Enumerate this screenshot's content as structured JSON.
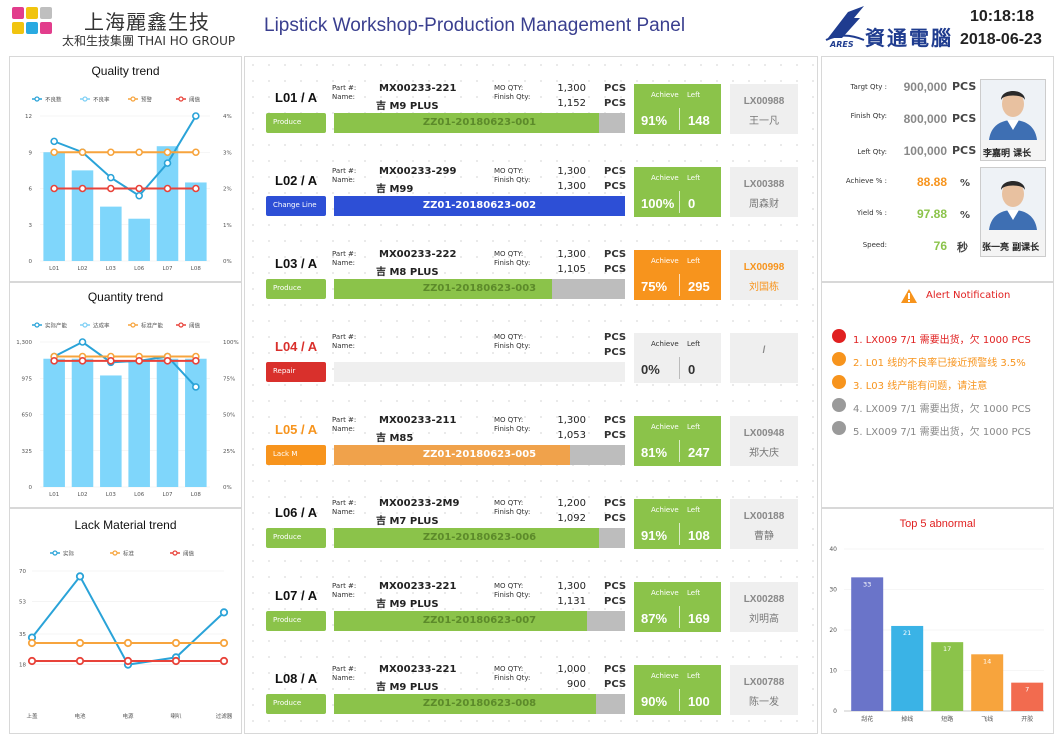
{
  "header": {
    "brand_cn": "上海麗鑫生技",
    "brand_en": "太和生技集團 THAI HO GROUP",
    "title": "Lipstick Workshop-Production Management Panel",
    "partner_logo_text": "ARES",
    "partner_name": "資通電腦",
    "time": "10:18:18",
    "date": "2018-06-23"
  },
  "quality_trend": {
    "title": "Quality trend",
    "legend": [
      "不良数",
      "不良率",
      "预警",
      "阈值"
    ],
    "chart_data": {
      "type": "bar",
      "categories": [
        "L01",
        "L02",
        "L03",
        "L06",
        "L07",
        "L08"
      ],
      "series": [
        {
          "name": "不良数",
          "values": [
            9,
            7.5,
            4.5,
            3.5,
            9.5,
            6.5
          ]
        },
        {
          "name": "不良率",
          "values": [
            3.3,
            3.0,
            2.3,
            1.8,
            2.7,
            4.0
          ]
        },
        {
          "name": "预警",
          "values": [
            3,
            3,
            3,
            3,
            3,
            3
          ]
        },
        {
          "name": "阈值",
          "values": [
            2,
            2,
            2,
            2,
            2,
            2
          ]
        }
      ],
      "ylim": [
        0,
        12
      ],
      "y2lim": [
        0,
        4
      ],
      "yticks": [
        "0",
        "3",
        "6",
        "9",
        "12"
      ],
      "y2ticks": [
        "0%",
        "1%",
        "2%",
        "3%",
        "4%"
      ]
    }
  },
  "quantity_trend": {
    "title": "Quantity trend",
    "legend": [
      "实际产能",
      "达成率",
      "标准产能",
      "阈值"
    ],
    "chart_data": {
      "type": "bar",
      "categories": [
        "L01",
        "L02",
        "L03",
        "L06",
        "L07",
        "L08"
      ],
      "series": [
        {
          "name": "实际产能",
          "values": [
            1150,
            1150,
            1000,
            1130,
            1150,
            1150
          ]
        },
        {
          "name": "达成率",
          "values": [
            90,
            100,
            86,
            87,
            90,
            69
          ]
        },
        {
          "name": "标准产能",
          "values": [
            90,
            90,
            90,
            90,
            90,
            90
          ]
        },
        {
          "name": "阈值",
          "values": [
            87,
            87,
            87,
            87,
            87,
            87
          ]
        }
      ],
      "ylim": [
        0,
        1300
      ],
      "y2lim": [
        0,
        100
      ],
      "yticks": [
        "0",
        "325",
        "650",
        "975",
        "1,300"
      ],
      "y2ticks": [
        "0%",
        "25%",
        "50%",
        "75%",
        "100%"
      ]
    }
  },
  "lack_trend": {
    "title": "Lack Material trend",
    "legend": [
      "实际",
      "标准",
      "阈值"
    ],
    "chart_data": {
      "type": "line",
      "categories": [
        "上盖",
        "电池",
        "电源",
        "喇叭",
        "过滤器"
      ],
      "series": [
        {
          "name": "实际",
          "values": [
            33,
            67,
            18,
            22,
            47
          ]
        },
        {
          "name": "标准",
          "values": [
            30,
            30,
            30,
            30,
            30
          ]
        },
        {
          "name": "阈值",
          "values": [
            20,
            20,
            20,
            20,
            20
          ]
        }
      ],
      "ylim": [
        0,
        70
      ],
      "yticks": [
        "18",
        "35",
        "53",
        "70"
      ]
    }
  },
  "lines": [
    {
      "name": "L01 / A",
      "name_color": "#111111",
      "status": "Produce",
      "status_color": "#8bc34a",
      "part_label": "Part #:",
      "name_label": "Name:",
      "part": "MX00233-221",
      "product": "吉 M9 PLUS",
      "mo_label": "MO QTY:",
      "finish_label": "Finish Qty:",
      "mo": "1,300",
      "fin": "1,152",
      "pcs": "PCS",
      "order": "ZZ01-20180623-001",
      "progress": 0.91,
      "bar_color": "#8bc34a",
      "text_color": "#5c8a2a",
      "ach_label": "Achieve",
      "left_label": "Left",
      "achieve": "91%",
      "left": "148",
      "ach_color": "#8bc34a",
      "op_id": "LX00988",
      "op_name": "王一凡",
      "op_color": "#888888"
    },
    {
      "name": "L02 / A",
      "name_color": "#111111",
      "status": "Change Line",
      "status_color": "#2d4fd6",
      "part_label": "Part #:",
      "name_label": "Name:",
      "part": "MX00233-299",
      "product": "吉 M99",
      "mo_label": "MO QTY:",
      "finish_label": "Finish Qty:",
      "mo": "1,300",
      "fin": "1,300",
      "pcs": "PCS",
      "order": "ZZ01-20180623-002",
      "progress": 1.0,
      "bar_color": "#2d4fd6",
      "text_color": "#ffffff",
      "ach_label": "Achieve",
      "left_label": "Left",
      "achieve": "100%",
      "left": "0",
      "ach_color": "#8bc34a",
      "op_id": "LX00388",
      "op_name": "周森财",
      "op_color": "#888888"
    },
    {
      "name": "L03 / A",
      "name_color": "#111111",
      "status": "Produce",
      "status_color": "#8bc34a",
      "part_label": "Part #:",
      "name_label": "Name:",
      "part": "MX00233-222",
      "product": "吉 M8 PLUS",
      "mo_label": "MO QTY:",
      "finish_label": "Finish Qty:",
      "mo": "1,300",
      "fin": "1,105",
      "pcs": "PCS",
      "order": "ZZ01-20180623-003",
      "progress": 0.75,
      "bar_color": "#8bc34a",
      "text_color": "#5c8a2a",
      "ach_label": "Achieve",
      "left_label": "Left",
      "achieve": "75%",
      "left": "295",
      "ach_color": "#f7941d",
      "op_id": "LX00998",
      "op_name": "刘国栋",
      "op_color": "#f7941d"
    },
    {
      "name": "L04 / A",
      "name_color": "#d9302c",
      "status": "Repair",
      "status_color": "#d9302c",
      "part_label": "Part #:",
      "name_label": "Name:",
      "part": "",
      "product": "",
      "mo_label": "MO QTY:",
      "finish_label": "Finish Qty:",
      "mo": "",
      "fin": "",
      "pcs": "PCS",
      "order": "",
      "progress": 0,
      "bar_color": "#efefef",
      "text_color": "#333333",
      "ach_label": "Achieve",
      "left_label": "Left",
      "achieve": "0%",
      "left": "0",
      "ach_color": "#efefef",
      "op_id": "/",
      "op_name": "",
      "op_color": "#888888"
    },
    {
      "name": "L05 / A",
      "name_color": "#f7941d",
      "status": "Lack  M",
      "status_color": "#f7941d",
      "part_label": "Part #:",
      "name_label": "Name:",
      "part": "MX00233-211",
      "product": "吉 M85",
      "mo_label": "MO QTY:",
      "finish_label": "Finish Qty:",
      "mo": "1,300",
      "fin": "1,053",
      "pcs": "PCS",
      "order": "ZZ01-20180623-005",
      "progress": 0.81,
      "bar_color": "#f0a24b",
      "text_color": "#ffffff",
      "ach_label": "Achieve",
      "left_label": "Left",
      "achieve": "81%",
      "left": "247",
      "ach_color": "#8bc34a",
      "op_id": "LX00948",
      "op_name": "郑大庆",
      "op_color": "#888888"
    },
    {
      "name": "L06 / A",
      "name_color": "#111111",
      "status": "Produce",
      "status_color": "#8bc34a",
      "part_label": "Part #:",
      "name_label": "Name:",
      "part": "MX00233-2M9",
      "product": "吉 M7 PLUS",
      "mo_label": "MO QTY:",
      "finish_label": "Finish Qty:",
      "mo": "1,200",
      "fin": "1,092",
      "pcs": "PCS",
      "order": "ZZ01-20180623-006",
      "progress": 0.91,
      "bar_color": "#8bc34a",
      "text_color": "#5c8a2a",
      "ach_label": "Achieve",
      "left_label": "Left",
      "achieve": "91%",
      "left": "108",
      "ach_color": "#8bc34a",
      "op_id": "LX00188",
      "op_name": "曹静",
      "op_color": "#888888"
    },
    {
      "name": "L07 / A",
      "name_color": "#111111",
      "status": "Produce",
      "status_color": "#8bc34a",
      "part_label": "Part #:",
      "name_label": "Name:",
      "part": "MX00233-221",
      "product": "吉 M9 PLUS",
      "mo_label": "MO QTY:",
      "finish_label": "Finish Qty:",
      "mo": "1,300",
      "fin": "1,131",
      "pcs": "PCS",
      "order": "ZZ01-20180623-007",
      "progress": 0.87,
      "bar_color": "#8bc34a",
      "text_color": "#5c8a2a",
      "ach_label": "Achieve",
      "left_label": "Left",
      "achieve": "87%",
      "left": "169",
      "ach_color": "#8bc34a",
      "op_id": "LX00288",
      "op_name": "刘明高",
      "op_color": "#888888"
    },
    {
      "name": "L08 / A",
      "name_color": "#111111",
      "status": "Produce",
      "status_color": "#8bc34a",
      "part_label": "Part #:",
      "name_label": "Name:",
      "part": "MX00233-221",
      "product": "吉 M9 PLUS",
      "mo_label": "MO QTY:",
      "finish_label": "Finish Qty:",
      "mo": "1,000",
      "fin": "900",
      "pcs": "PCS",
      "order": "ZZ01-20180623-008",
      "progress": 0.9,
      "bar_color": "#8bc34a",
      "text_color": "#5c8a2a",
      "ach_label": "Achieve",
      "left_label": "Left",
      "achieve": "90%",
      "left": "100",
      "ach_color": "#8bc34a",
      "op_id": "LX00788",
      "op_name": "陈一发",
      "op_color": "#888888"
    }
  ],
  "kpi": {
    "target_label": "Targt Qty :",
    "target": "900,000",
    "finish_label": "Finish Qty:",
    "finish": "800,000",
    "left_label": "Left  Qty:",
    "left": "100,000",
    "unit_pcs": "PCS",
    "achieve_label": "Achieve % :",
    "achieve": "88.88",
    "yield_label": "Yield  % :",
    "yield": "97.88",
    "speed_label": "Speed:",
    "speed": "76",
    "unit_pct": "%",
    "unit_sec": "秒",
    "manager1": "李嘉明 课长",
    "manager2": "张一亮 副课长",
    "achieve_color": "#f7941d",
    "green": "#8bc34a"
  },
  "alerts": {
    "title": "Alert Notification",
    "items": [
      {
        "text": "1.  LX009  7/1 需要出货，欠 1000 PCS",
        "color": "#e02020",
        "dot": "#e02020"
      },
      {
        "text": "2.  L01 线的不良率已接近预警线 3.5%",
        "color": "#f7941d",
        "dot": "#f7941d"
      },
      {
        "text": "3. L03 线产能有问题，请注意",
        "color": "#f7941d",
        "dot": "#f7941d"
      },
      {
        "text": "4.  LX009  7/1 需要出货，欠 1000 PCS",
        "color": "#888888",
        "dot": "#9a9a9a"
      },
      {
        "text": "5.  LX009  7/1 需要出货，欠 1000 PCS",
        "color": "#888888",
        "dot": "#9a9a9a"
      }
    ]
  },
  "top5": {
    "title": "Top 5 abnormal",
    "chart_data": {
      "type": "bar",
      "categories": [
        "刮花",
        "掉线",
        "短路",
        "飞线",
        "开胶"
      ],
      "values": [
        33,
        21,
        17,
        14,
        7
      ],
      "colors": [
        "#6a74c9",
        "#3ab3e6",
        "#8bc34a",
        "#f7a43d",
        "#f26b4f"
      ],
      "ylim": [
        0,
        40
      ],
      "yticks": [
        "0",
        "10",
        "20",
        "30",
        "40"
      ]
    }
  }
}
